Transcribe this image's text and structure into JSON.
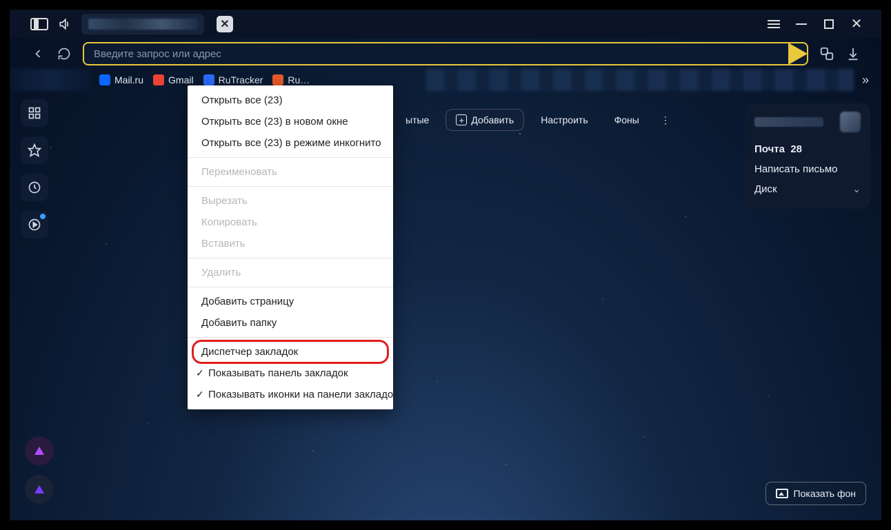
{
  "addressbar": {
    "placeholder": "Введите запрос или адрес"
  },
  "bookmarks_bar": [
    {
      "label": "Mail.ru",
      "color": "#ff9a00"
    },
    {
      "label": "Gmail",
      "color": "#ea4335"
    },
    {
      "label": "RuTracker",
      "color": "#3b82f6"
    },
    {
      "label": "Ru…",
      "color": "#e85a2a"
    }
  ],
  "chips": {
    "hidden_tail": "ытые",
    "add": "Добавить",
    "configure": "Настроить",
    "backgrounds": "Фоны"
  },
  "context_menu": {
    "open_all": "Открыть все (23)",
    "open_all_new_window": "Открыть все (23) в новом окне",
    "open_all_incognito": "Открыть все (23) в режиме инкогнито",
    "rename": "Переименовать",
    "cut": "Вырезать",
    "copy": "Копировать",
    "paste": "Вставить",
    "delete": "Удалить",
    "add_page": "Добавить страницу",
    "add_folder": "Добавить папку",
    "bookmark_manager": "Диспетчер закладок",
    "show_bar": "Показывать панель закладок",
    "show_icons": "Показывать иконки на панели закладок"
  },
  "user_panel": {
    "mail_label": "Почта",
    "mail_count": "28",
    "compose": "Написать письмо",
    "disk": "Диск"
  },
  "bottom_right": {
    "show_background": "Показать фон"
  }
}
